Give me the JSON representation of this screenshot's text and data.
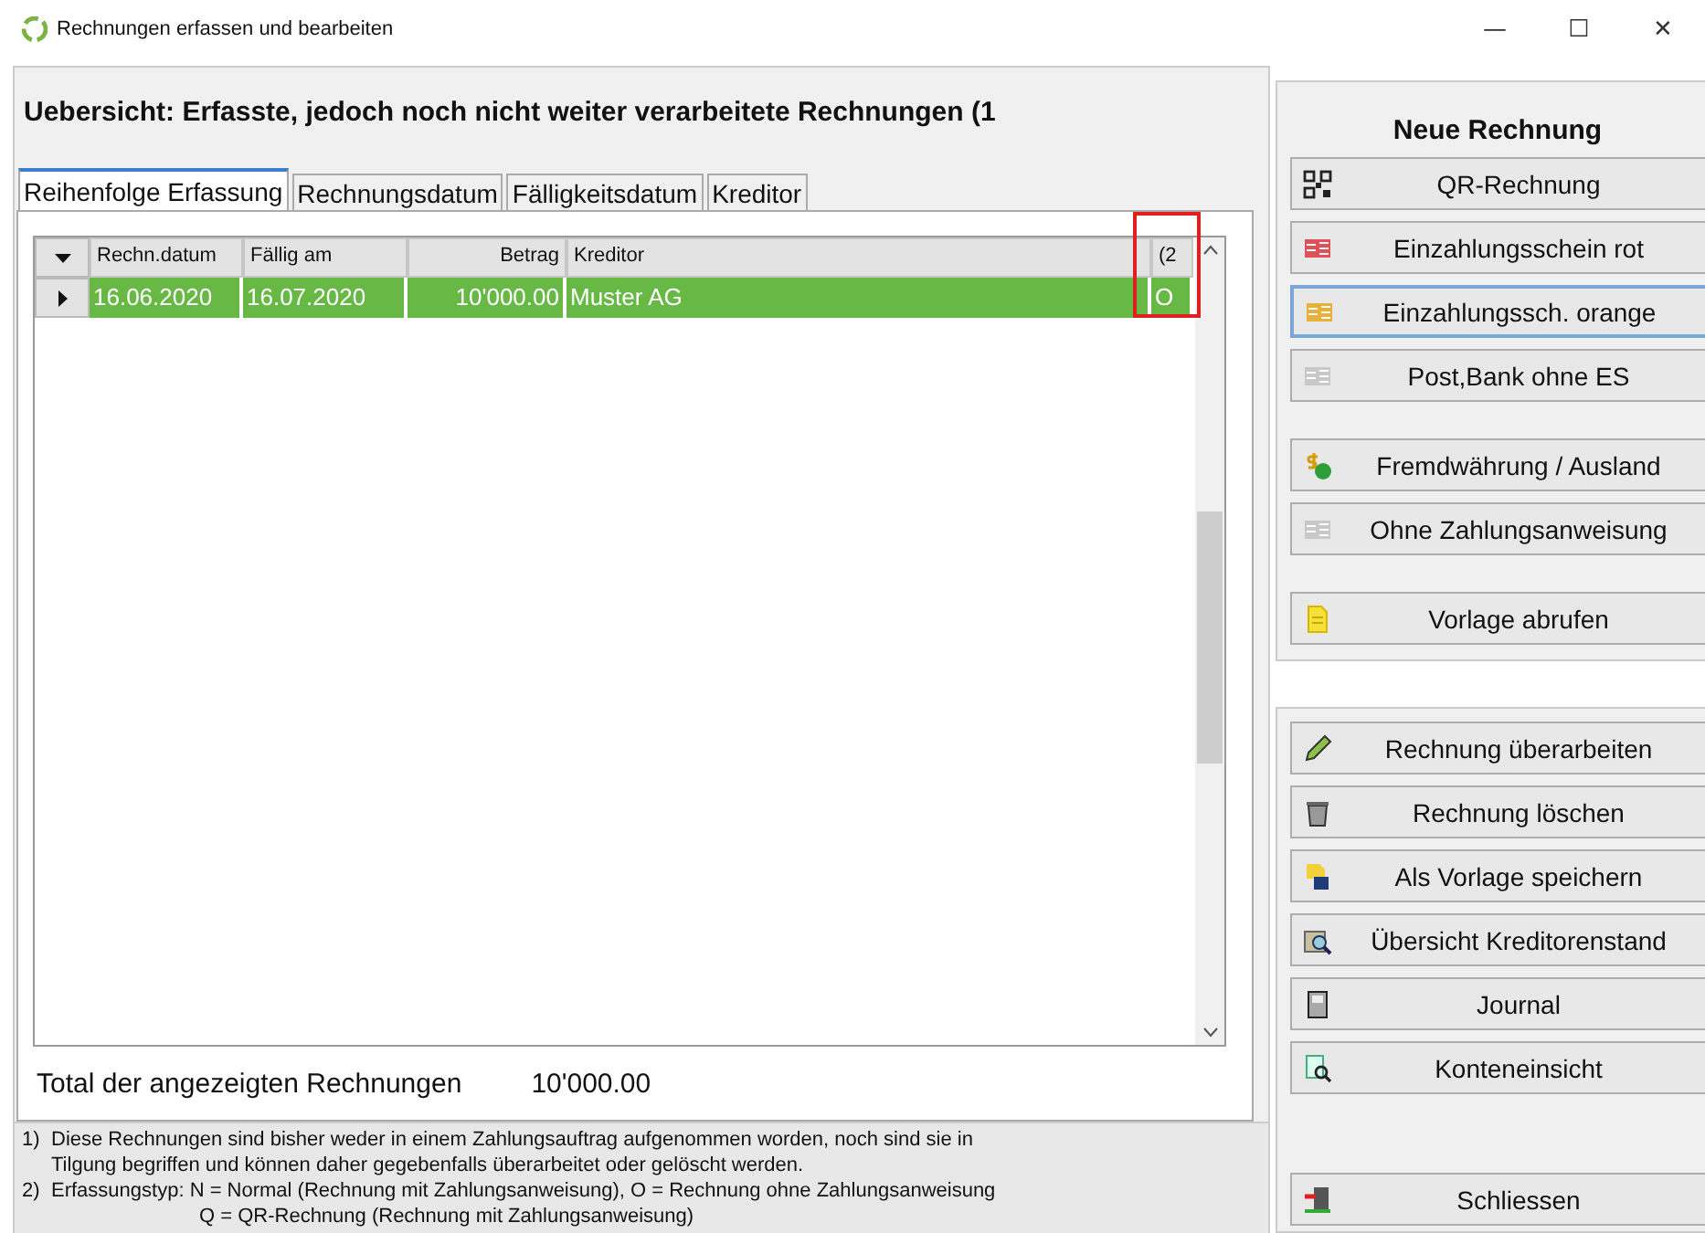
{
  "window": {
    "title": "Rechnungen erfassen und bearbeiten",
    "controls": [
      "—",
      "☐",
      "✕"
    ]
  },
  "heading": "Uebersicht: Erfasste, jedoch noch nicht weiter verarbeitete Rechnungen (1",
  "tabs": [
    {
      "label": "Reihenfolge Erfassung",
      "selected": true
    },
    {
      "label": "Rechnungsdatum",
      "selected": false
    },
    {
      "label": "Fälligkeitsdatum",
      "selected": false
    },
    {
      "label": "Kreditor",
      "selected": false
    }
  ],
  "table": {
    "columns": [
      {
        "label": "Rechn.datum",
        "highlighted": false
      },
      {
        "label": "Fällig am",
        "highlighted": false
      },
      {
        "label": "Betrag",
        "highlighted": false
      },
      {
        "label": "Kreditor",
        "highlighted": false
      },
      {
        "label": "(2",
        "highlighted": true
      }
    ],
    "rows": [
      {
        "selected": true,
        "cells": [
          "16.06.2020",
          "16.07.2020",
          "10'000.00",
          "Muster AG",
          "O"
        ]
      }
    ]
  },
  "total": {
    "label": "Total der angezeigten Rechnungen",
    "value": "10'000.00"
  },
  "footnotes": [
    {
      "mark": "1)",
      "lines": [
        "Diese Rechnungen sind bisher weder in einem Zahlungsauftrag aufgenommen worden, noch sind sie in",
        "Tilgung begriffen und können daher gegebenfalls überarbeitet oder gelöscht werden."
      ]
    },
    {
      "mark": "2)",
      "lines": [
        "Erfassungstyp: N = Normal (Rechnung mit Zahlungsanweisung), O = Rechnung ohne Zahlungsanweisung",
        "Q = QR-Rechnung (Rechnung mit Zahlungsanweisung)"
      ]
    }
  ],
  "new_invoice": {
    "title": "Neue Rechnung",
    "groups": [
      [
        {
          "label": "QR-Rechnung",
          "kind": "qr",
          "focused": false
        },
        {
          "label": "Einzahlungsschein rot",
          "kind": "slip_red",
          "focused": false
        },
        {
          "label": "Einzahlungssch. orange",
          "kind": "slip_orange",
          "focused": true
        },
        {
          "label": "Post,Bank ohne ES",
          "kind": "slip_grey",
          "focused": false
        }
      ],
      [
        {
          "label": "Fremdwährung / Ausland",
          "kind": "currency",
          "focused": false
        },
        {
          "label": "Ohne Zahlungsanweisung",
          "kind": "slip_grey",
          "focused": false
        }
      ],
      [
        {
          "label": "Vorlage abrufen",
          "kind": "note",
          "focused": false
        }
      ]
    ]
  },
  "actions": {
    "groups": [
      [
        {
          "label": "Rechnung überarbeiten",
          "kind": "pencil",
          "focused": false
        },
        {
          "label": "Rechnung löschen",
          "kind": "bin",
          "focused": false
        },
        {
          "label": "Als Vorlage speichern",
          "kind": "save",
          "focused": false
        },
        {
          "label": "Übersicht Kreditorenstand",
          "kind": "magnifier",
          "focused": false
        },
        {
          "label": "Journal",
          "kind": "book",
          "focused": false
        },
        {
          "label": "Konteneinsicht",
          "kind": "sheet",
          "focused": false
        }
      ],
      [
        {
          "label": "Schliessen",
          "kind": "exit",
          "focused": false
        }
      ]
    ]
  }
}
